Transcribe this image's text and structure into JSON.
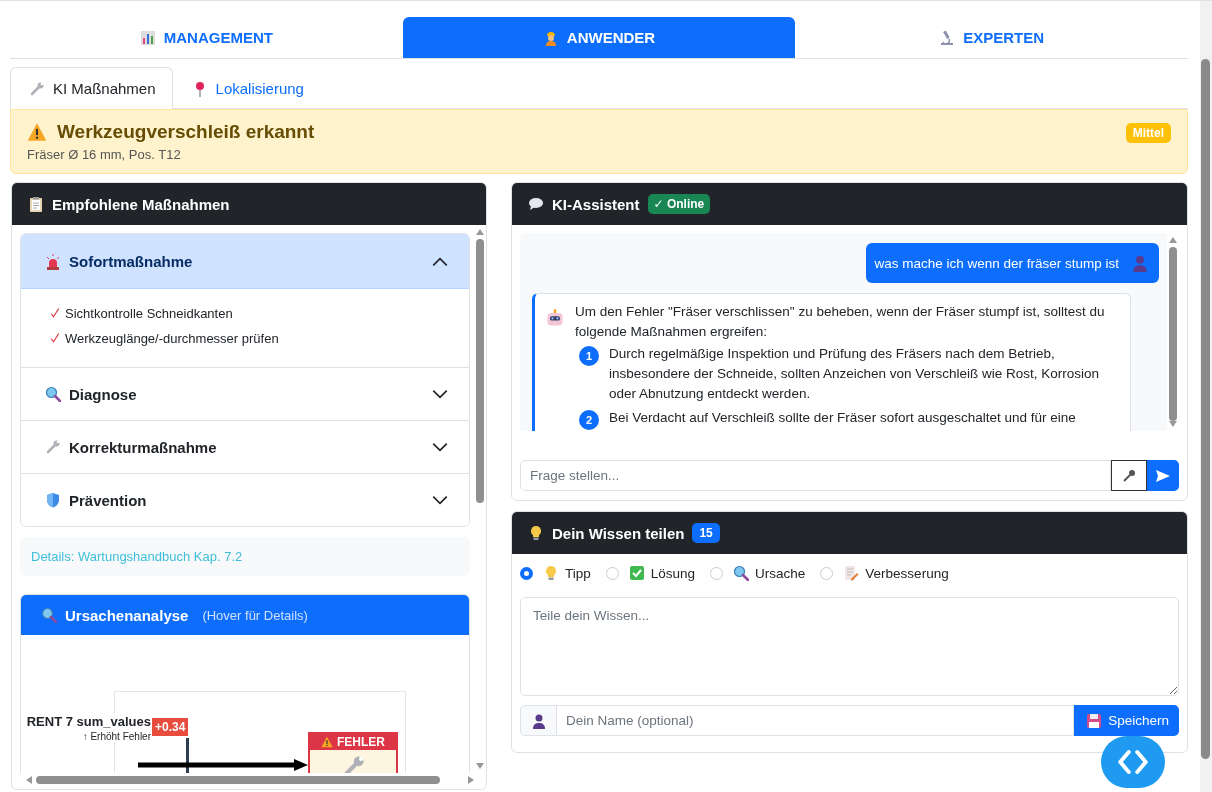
{
  "main_tabs": [
    {
      "label": "MANAGEMENT",
      "selected": false
    },
    {
      "label": "ANWENDER",
      "selected": true
    },
    {
      "label": "EXPERTEN",
      "selected": false
    }
  ],
  "sub_tabs": [
    {
      "label": "KI Maßnahmen",
      "selected": true
    },
    {
      "label": "Lokalisierung",
      "selected": false
    }
  ],
  "alert": {
    "title": "Werkzeugverschleiß erkannt",
    "subtitle": "Fräser Ø 16 mm, Pos. T12",
    "severity": "Mittel"
  },
  "measures": {
    "title": "Empfohlene Maßnahmen",
    "sections": [
      {
        "title": "Sofortmaßnahme",
        "expanded": true,
        "items": [
          "Sichtkontrolle Schneidkanten",
          "Werkzeuglänge/-durchmesser prüfen"
        ]
      },
      {
        "title": "Diagnose",
        "expanded": false
      },
      {
        "title": "Korrekturmaßnahme",
        "expanded": false
      },
      {
        "title": "Prävention",
        "expanded": false
      }
    ],
    "details": "Details: Wartungshandbuch Kap. 7.2"
  },
  "cause_analysis": {
    "title": "Ursachenanalyse",
    "hint": "(Hover für Details)",
    "diagram": {
      "feature": "RENT 7 sum_values",
      "effect": "↑ Erhöht Fehler",
      "impact": "+0.34",
      "target": "FEHLER"
    }
  },
  "assistant": {
    "title": "KI-Assistent",
    "status": "✓ Online",
    "messages": [
      {
        "kind": "user",
        "text": "was mache ich wenn der fräser stump ist"
      },
      {
        "kind": "bot",
        "text": "Um den Fehler \"Fräser verschlissen\" zu beheben, wenn der Fräser stumpf ist, solltest du folgende Maßnahmen ergreifen:",
        "steps": [
          {
            "number": "1",
            "text": "Durch regelmäßige Inspektion und Prüfung des Fräsers nach dem Betrieb, insbesondere der Schneide, sollten Anzeichen von Verschleiß wie Rost, Korrosion oder Abnutzung entdeckt werden."
          },
          {
            "number": "2",
            "text": "Bei Verdacht auf Verschleiß sollte der Fräser sofort ausgeschaltet und für eine"
          }
        ]
      }
    ],
    "input_placeholder": "Frage stellen..."
  },
  "knowledge": {
    "title": "Dein Wissen teilen",
    "count": "15",
    "types": [
      {
        "label": "Tipp",
        "selected": true
      },
      {
        "label": "Lösung",
        "selected": false
      },
      {
        "label": "Ursache",
        "selected": false
      },
      {
        "label": "Verbesserung",
        "selected": false
      }
    ],
    "text_placeholder": "Teile dein Wissen...",
    "name_placeholder": "Dein Name (optional)",
    "save": "Speichern"
  }
}
